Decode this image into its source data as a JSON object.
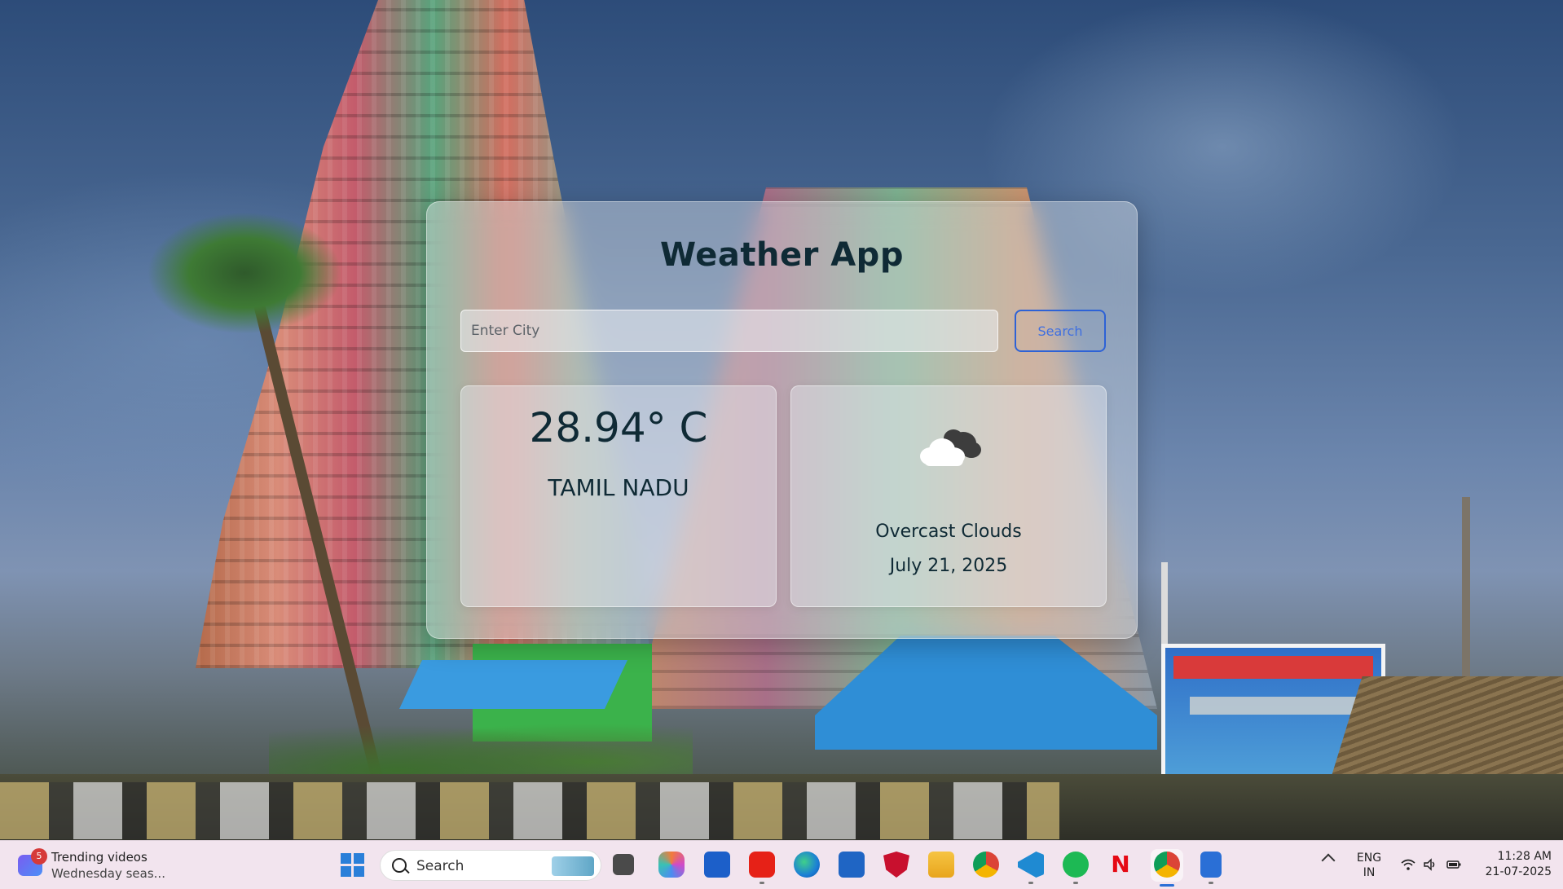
{
  "weather_app": {
    "title": "Weather App",
    "search_placeholder": "Enter City",
    "search_button": "Search",
    "temperature": "28.94° C",
    "location": "TAMIL NADU",
    "condition_icon": "overcast-cloud-icon",
    "description": "Overcast Clouds",
    "date": "July 21, 2025"
  },
  "taskbar": {
    "widget": {
      "badge_count": "5",
      "title": "Trending videos",
      "subtitle": "Wednesday seas..."
    },
    "search_label": "Search",
    "apps": [
      "task-view-icon",
      "copilot-icon",
      "editor-icon",
      "youtube-icon",
      "edge-icon",
      "store-icon",
      "mcafee-icon",
      "file-explorer-icon",
      "chrome-icon",
      "vscode-icon",
      "spotify-icon",
      "netflix-icon",
      "chrome-profile-icon",
      "notepad-icon"
    ],
    "language": {
      "line1": "ENG",
      "line2": "IN"
    },
    "time": "11:28 AM",
    "date": "21-07-2025"
  },
  "colors": {
    "title_text": "#0f2a35",
    "search_button_border": "#2d62d6",
    "taskbar_bg": "#f2e4ee"
  }
}
